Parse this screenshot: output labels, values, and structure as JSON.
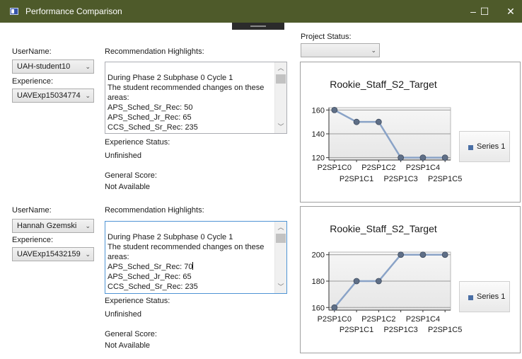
{
  "window": {
    "title": "Performance Comparison",
    "controls": {
      "minimize": "–",
      "maximize": "☐",
      "close": "✕"
    }
  },
  "project_status": {
    "label": "Project Status:",
    "value": ""
  },
  "students": [
    {
      "username_label": "UserName:",
      "username": "UAH-student10",
      "experience_label": "Experience:",
      "experience": "UAVExp15034774",
      "rec_label": "Recommendation Highlights:",
      "rec_lines": [
        "During Phase 2 Subphase 0 Cycle 1",
        "The student recommended changes on these",
        "areas:",
        "APS_Sched_Sr_Rec: 50",
        "APS_Sched_Jr_Rec: 65",
        "CCS_Sched_Sr_Rec: 235"
      ],
      "status_label": "Experience Status:",
      "status": "Unfinished",
      "score_label": "General Score:",
      "score": "Not Available"
    },
    {
      "username_label": "UserName:",
      "username": "Hannah Gzemski",
      "experience_label": "Experience:",
      "experience": "UAVExp15432159",
      "rec_label": "Recommendation Highlights:",
      "rec_lines": [
        "During Phase 2 Subphase 0 Cycle 1",
        "The student recommended changes on these",
        "areas:",
        "APS_Sched_Sr_Rec: 70",
        "APS_Sched_Jr_Rec: 65",
        "CCS_Sched_Sr_Rec: 235"
      ],
      "status_label": "Experience Status:",
      "status": "Unfinished",
      "score_label": "General Score:",
      "score": "Not Available"
    }
  ],
  "charts": [
    {
      "type": "line",
      "title": "Rookie_Staff_S2_Target",
      "categories": [
        "P2SP1C0",
        "P2SP1C1",
        "P2SP1C2",
        "P2SP1C3",
        "P2SP1C4",
        "P2SP1C5"
      ],
      "series": [
        {
          "name": "Series 1",
          "values": [
            160,
            150,
            150,
            120,
            120,
            120
          ]
        }
      ],
      "yticks": [
        120,
        140,
        160
      ],
      "ylim": [
        118,
        162
      ],
      "legend_position": "right",
      "grid": true,
      "colors": {
        "line": "#8aa3c7",
        "marker": "#5f6f87",
        "plot_bg": "#e6e6e6"
      }
    },
    {
      "type": "line",
      "title": "Rookie_Staff_S2_Target",
      "categories": [
        "P2SP1C0",
        "P2SP1C1",
        "P2SP1C2",
        "P2SP1C3",
        "P2SP1C4",
        "P2SP1C5"
      ],
      "series": [
        {
          "name": "Series 1",
          "values": [
            160,
            180,
            180,
            200,
            200,
            200
          ]
        }
      ],
      "yticks": [
        160,
        180,
        200
      ],
      "ylim": [
        158,
        202
      ],
      "legend_position": "right",
      "grid": true,
      "colors": {
        "line": "#8aa3c7",
        "marker": "#5f6f87",
        "plot_bg": "#e6e6e6"
      }
    }
  ]
}
